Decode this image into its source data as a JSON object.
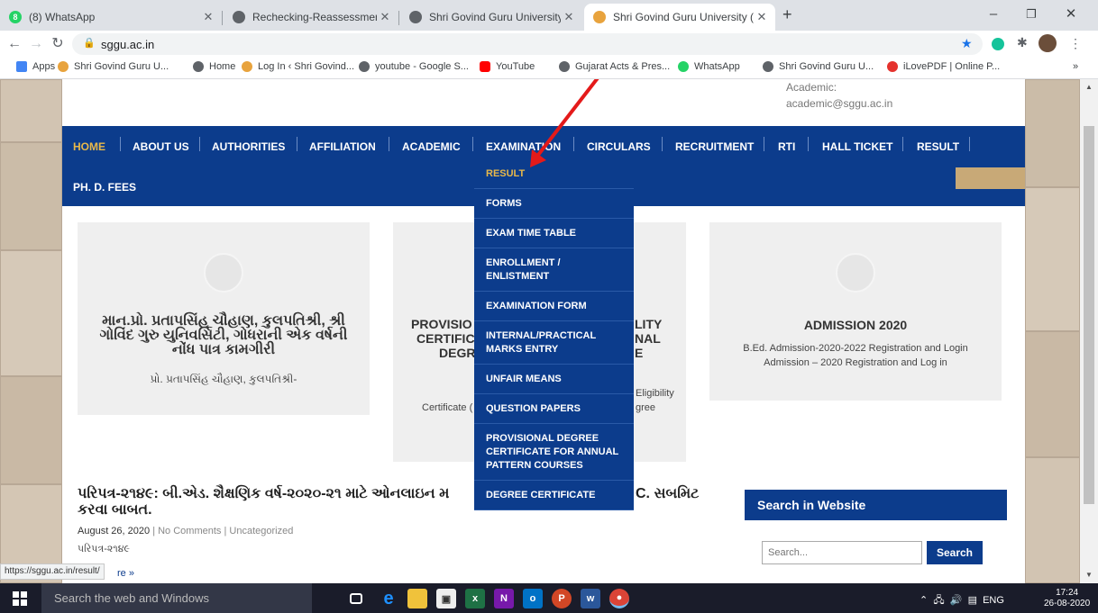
{
  "browser": {
    "tabs": [
      {
        "label": "(8) WhatsApp",
        "icon": "whatsapp-icon",
        "color": "#25d366"
      },
      {
        "label": "Rechecking-Reassessment-Online",
        "icon": "globe-icon",
        "color": "#5f6368"
      },
      {
        "label": "Shri Govind Guru University Godh",
        "icon": "globe-icon",
        "color": "#5f6368"
      },
      {
        "label": "Shri Govind Guru University (SGG",
        "icon": "sggu-favicon",
        "color": "#e8a33d"
      }
    ],
    "new_tab": "+",
    "url": "sggu.ac.in",
    "bookmarks": [
      {
        "label": "Apps",
        "color": "#4285f4"
      },
      {
        "label": "Shri Govind Guru U...",
        "color": "#e8a33d"
      },
      {
        "label": "Home",
        "color": "#5f6368"
      },
      {
        "label": "Log In ‹ Shri Govind...",
        "color": "#e8a33d"
      },
      {
        "label": "youtube - Google S...",
        "color": "#5f6368"
      },
      {
        "label": "YouTube",
        "color": "#ff0000"
      },
      {
        "label": "Gujarat Acts & Pres...",
        "color": "#5f6368"
      },
      {
        "label": "WhatsApp",
        "color": "#25d366"
      },
      {
        "label": "Shri Govind Guru U...",
        "color": "#5f6368"
      },
      {
        "label": "iLovePDF | Online P...",
        "color": "#e5322d"
      }
    ],
    "bookmarks_overflow": "»",
    "status_url": "https://sggu.ac.in/result/"
  },
  "site": {
    "top_info": [
      "Academic:",
      "academic@sggu.ac.in"
    ],
    "nav": [
      "HOME",
      "ABOUT US",
      "AUTHORITIES",
      "AFFILIATION",
      "ACADEMIC",
      "EXAMINATION",
      "CIRCULARS",
      "RECRUITMENT",
      "RTI",
      "HALL TICKET",
      "RESULT",
      "PH. D. FEES"
    ],
    "dropdown": [
      "RESULT",
      "FORMS",
      "EXAM TIME TABLE",
      "ENROLLMENT / ENLISTMENT",
      "EXAMINATION FORM",
      "INTERNAL/PRACTICAL MARKS ENTRY",
      "UNFAIR MEANS",
      "QUESTION PAPERS",
      "PROVISIONAL DEGREE CERTIFICATE FOR ANNUAL PATTERN COURSES",
      "DEGREE CERTIFICATE"
    ],
    "card1": {
      "title": "માન.પ્રો. પ્રતાપસિંહ ચૌહાણ, કુલપતિશ્રી, શ્રી ગોવિંદ ગુરુ યુનિવર્સિટી, ગોધરાની એક વર્ષની નોંધ પાત્ર કામગીરી",
      "text": "પ્રો. પ્રતાપસિંહ ચૌહાણ, કુલપતિશ્રી-"
    },
    "card2": {
      "title_left": "PROVISIO",
      "title_left2": "CERTIFIC",
      "title_left3": "DEGR",
      "title_right": "LITY",
      "title_right2": "NAL",
      "title_right3": "E",
      "text_left": "Certificate (",
      "text_right": "Eligibility",
      "text_right2": "gree"
    },
    "card3": {
      "title": "ADMISSION 2020",
      "line1": "B.Ed. Admission-2020-2022 Registration and Login",
      "line2": "Admission – 2020 Registration and Log in"
    },
    "post": {
      "title_left": "પરિપત્ર-૨૧૪૯: બી.એડ. શૈક્ષણિક વર્ષ-૨૦૨૦-૨૧ માટે ઓનલાઇન મ",
      "title_right": "C. સબમિટ",
      "title_line2": "કરવા બાબત.",
      "date": "August 26, 2020",
      "sep": "|",
      "comments": "No Comments",
      "category": "Uncategorized",
      "excerpt": "પરિપત્ર-૨૧૪૯",
      "read_more": "re »"
    },
    "search": {
      "heading": "Search in Website",
      "placeholder": "Search...",
      "button": "Search"
    }
  },
  "taskbar": {
    "search_placeholder": "Search the web and Windows",
    "tray": "ENG",
    "time": "17:24",
    "date": "26-08-2020"
  }
}
